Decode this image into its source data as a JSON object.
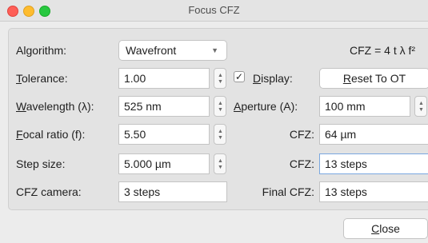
{
  "window": {
    "title": "Focus CFZ"
  },
  "algorithm": {
    "label_pre": "Al",
    "label_ul": "g",
    "label_post": "orithm:",
    "value": "Wavefront",
    "formula": "CFZ = 4 t λ f²"
  },
  "tolerance": {
    "label_ul": "T",
    "label_post": "olerance:",
    "value": "1.00"
  },
  "display": {
    "checked_glyph": "✓",
    "label_ul": "D",
    "label_post": "isplay:"
  },
  "reset_button": {
    "label_ul": "R",
    "label_post": "eset To OT"
  },
  "wavelength": {
    "label_ul": "W",
    "label_post": "avelength (λ):",
    "value": "525 nm"
  },
  "aperture": {
    "label_ul": "A",
    "label_post": "perture (A):",
    "value": "100 mm"
  },
  "focal_ratio": {
    "label_ul": "F",
    "label_post": "ocal ratio (f):",
    "value": "5.50"
  },
  "cfz_um": {
    "label": "CFZ:",
    "value": "64 µm"
  },
  "step_size": {
    "label": "Step size:",
    "value": "5.000 µm"
  },
  "cfz_steps": {
    "label": "CFZ:",
    "value": "13 steps"
  },
  "cfz_camera": {
    "label": "CFZ camera:",
    "value": "3 steps"
  },
  "final_cfz": {
    "label": "Final CFZ:",
    "value": "13 steps"
  },
  "close_button": {
    "label_ul": "C",
    "label_post": "lose"
  },
  "icons": {
    "spin_up": "▲",
    "spin_down": "▼",
    "combo_caret": "▼"
  },
  "colors": {
    "close": "#fe5f57",
    "minimize": "#febc2e",
    "maximize": "#28c840",
    "focus_border": "#7aa7e0"
  }
}
